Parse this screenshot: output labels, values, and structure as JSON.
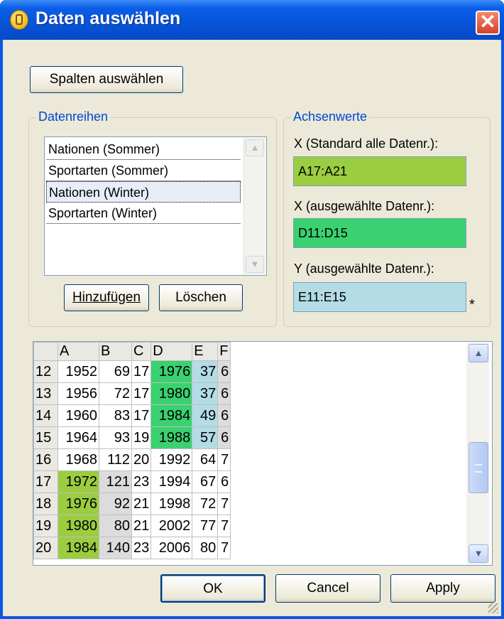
{
  "window": {
    "title": "Daten auswählen",
    "close_glyph": "✕",
    "app_icon": "database-icon"
  },
  "buttons": {
    "select_columns": "Spalten auswählen",
    "add": "Hinzufügen",
    "delete": "Löschen",
    "ok": "OK",
    "cancel": "Cancel",
    "apply": "Apply"
  },
  "series_group": {
    "legend": "Datenreihen",
    "items": [
      "Nationen (Sommer)",
      "Sportarten (Sommer)",
      "Nationen (Winter)",
      "Sportarten (Winter)"
    ],
    "selected_index": 2
  },
  "axis_group": {
    "legend": "Achsenwerte",
    "x_default_label": "X (Standard alle Datenr.):",
    "x_default_value": "A17:A21",
    "x_selected_label": "X (ausgewählte Datenr.):",
    "x_selected_value": "D11:D15",
    "y_selected_label": "Y (ausgewählte Datenr.):",
    "y_selected_value": "E11:E15",
    "required_marker": "*"
  },
  "grid": {
    "columns": [
      "A",
      "B",
      "C",
      "D",
      "E",
      "F"
    ],
    "rows": [
      {
        "n": "12",
        "cells": [
          "1952",
          "69",
          "17",
          "1976",
          "37",
          "6"
        ]
      },
      {
        "n": "13",
        "cells": [
          "1956",
          "72",
          "17",
          "1980",
          "37",
          "6"
        ]
      },
      {
        "n": "14",
        "cells": [
          "1960",
          "83",
          "17",
          "1984",
          "49",
          "6"
        ]
      },
      {
        "n": "15",
        "cells": [
          "1964",
          "93",
          "19",
          "1988",
          "57",
          "6"
        ]
      },
      {
        "n": "16",
        "cells": [
          "1968",
          "112",
          "20",
          "1992",
          "64",
          "7"
        ]
      },
      {
        "n": "17",
        "cells": [
          "1972",
          "121",
          "23",
          "1994",
          "67",
          "6"
        ]
      },
      {
        "n": "18",
        "cells": [
          "1976",
          "92",
          "21",
          "1998",
          "72",
          "7"
        ]
      },
      {
        "n": "19",
        "cells": [
          "1980",
          "80",
          "21",
          "2002",
          "77",
          "7"
        ]
      },
      {
        "n": "20",
        "cells": [
          "1984",
          "140",
          "23",
          "2006",
          "80",
          "7"
        ]
      }
    ],
    "highlight_colors": {
      "x_default": "#9acd40",
      "x_selected": "#3ad170",
      "y_selected": "#b3dce6"
    }
  },
  "colors": {
    "titlebar": "#0754d8",
    "dialog_bg": "#ece9d8",
    "group_legend": "#0046d5",
    "close_button": "#d6402a"
  }
}
